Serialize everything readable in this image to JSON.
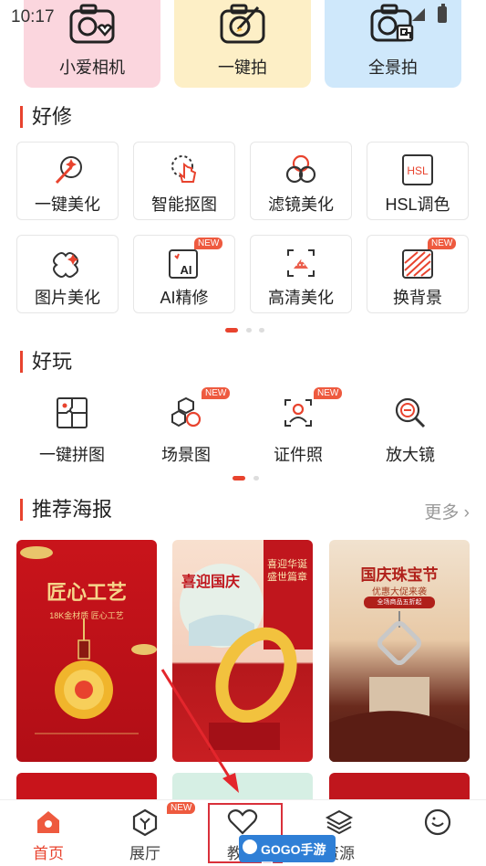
{
  "status": {
    "time": "10:17"
  },
  "cameras": [
    {
      "label": "小爱相机",
      "color": "#fbd6de"
    },
    {
      "label": "一键拍",
      "color": "#fdefc6"
    },
    {
      "label": "全景拍",
      "color": "#cfe8fb"
    }
  ],
  "edit_section": {
    "title": "好修",
    "tools": [
      {
        "label": "一键美化",
        "icon": "magic-wand-icon"
      },
      {
        "label": "智能抠图",
        "icon": "smart-cutout-icon"
      },
      {
        "label": "滤镜美化",
        "icon": "filter-icon"
      },
      {
        "label": "HSL调色",
        "icon": "hsl-icon",
        "icon_text": "HSL"
      },
      {
        "label": "图片美化",
        "icon": "sparkle-puzzle-icon"
      },
      {
        "label": "AI精修",
        "icon": "ai-retouch-icon",
        "icon_text": "AI",
        "badge": "NEW"
      },
      {
        "label": "高清美化",
        "icon": "hd-icon"
      },
      {
        "label": "换背景",
        "icon": "background-icon",
        "badge": "NEW"
      }
    ]
  },
  "play_section": {
    "title": "好玩",
    "tools": [
      {
        "label": "一键拼图",
        "icon": "collage-icon"
      },
      {
        "label": "场景图",
        "icon": "scene-icon",
        "badge": "NEW"
      },
      {
        "label": "证件照",
        "icon": "id-photo-icon",
        "badge": "NEW"
      },
      {
        "label": "放大镜",
        "icon": "magnifier-icon"
      }
    ]
  },
  "poster_section": {
    "title": "推荐海报",
    "more": "更多",
    "posters": [
      {
        "title": "匠心工艺",
        "subtitle": "18K金材质  匠心工艺"
      },
      {
        "title": "喜迎国庆",
        "subtitle": "喜迎华诞 盛世篇章"
      },
      {
        "title": "国庆珠宝节",
        "subtitle": "优惠大促来袭",
        "tag": "全场商品五折起"
      }
    ]
  },
  "tabbar": {
    "tabs": [
      {
        "label": "首页",
        "icon": "home-icon",
        "active": true
      },
      {
        "label": "展厅",
        "icon": "gallery-icon",
        "badge": "NEW"
      },
      {
        "label": "教程",
        "icon": "heart-icon"
      },
      {
        "label": "资源",
        "icon": "layers-icon"
      },
      {
        "label": "",
        "icon": "profile-icon"
      }
    ]
  },
  "watermark": "GOGO手游网"
}
